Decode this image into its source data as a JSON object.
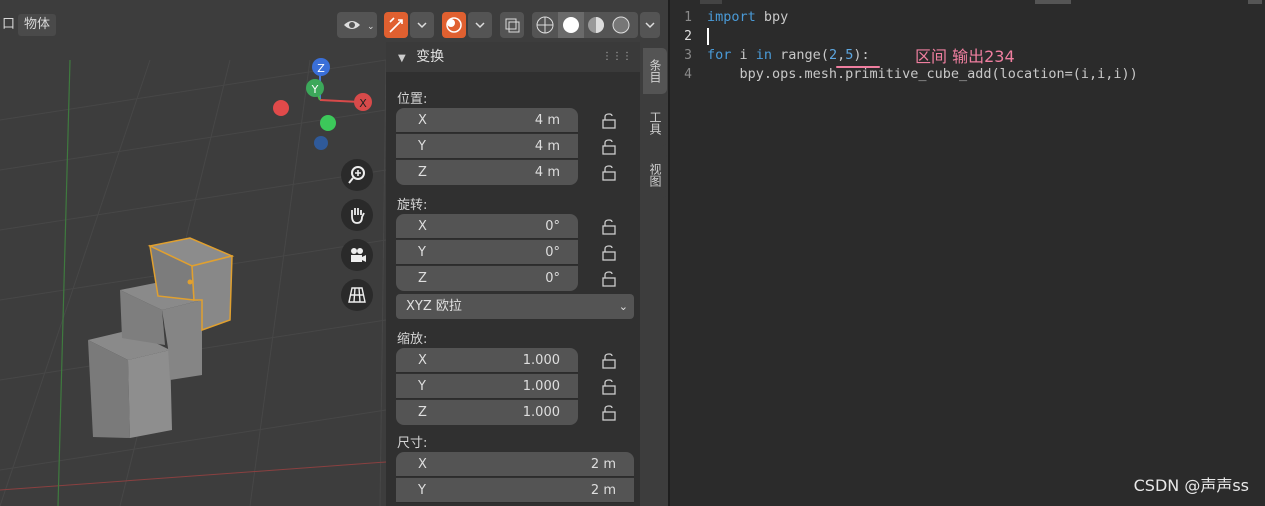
{
  "viewport": {
    "header": {
      "menu_left": "口",
      "menu_object": "物体"
    },
    "gizmo": {
      "z_label": "Z",
      "y_label": "Y",
      "x_label": "X"
    },
    "icons": [
      "zoom-icon",
      "hand-pan-icon",
      "camera-icon",
      "perspective-grid-icon"
    ]
  },
  "npanel": {
    "header": "变换",
    "location": {
      "label": "位置:",
      "rows": [
        {
          "axis": "X",
          "value": "4 m"
        },
        {
          "axis": "Y",
          "value": "4 m"
        },
        {
          "axis": "Z",
          "value": "4 m"
        }
      ]
    },
    "rotation": {
      "label": "旋转:",
      "rows": [
        {
          "axis": "X",
          "value": "0°"
        },
        {
          "axis": "Y",
          "value": "0°"
        },
        {
          "axis": "Z",
          "value": "0°"
        }
      ]
    },
    "rotation_mode": "XYZ 欧拉",
    "scale": {
      "label": "缩放:",
      "rows": [
        {
          "axis": "X",
          "value": "1.000"
        },
        {
          "axis": "Y",
          "value": "1.000"
        },
        {
          "axis": "Z",
          "value": "1.000"
        }
      ]
    },
    "dimensions": {
      "label": "尺寸:",
      "rows": [
        {
          "axis": "X",
          "value": "2 m"
        },
        {
          "axis": "Y",
          "value": "2 m"
        }
      ]
    }
  },
  "side_tabs": [
    "条目",
    "工具",
    "视图"
  ],
  "editor": {
    "line_numbers": [
      "1",
      "2",
      "3",
      "4"
    ],
    "lines": {
      "l1_kw": "import",
      "l1_rest": " bpy",
      "l3_for": "for",
      "l3_mid": " i ",
      "l3_in": "in",
      "l3_range": " range(",
      "l3_a": "2",
      "l3_comma": ",",
      "l3_b": "5",
      "l3_end": "):",
      "l4": "    bpy.ops.mesh.primitive_cube_add(location=(i,i,i))"
    },
    "annotation": "区间 输出234",
    "watermark": "CSDN @声声ss"
  },
  "colors": {
    "accent_orange": "#e0a030",
    "annotation_pink": "#f07fa0",
    "keyword_blue": "#4a9bd8"
  }
}
